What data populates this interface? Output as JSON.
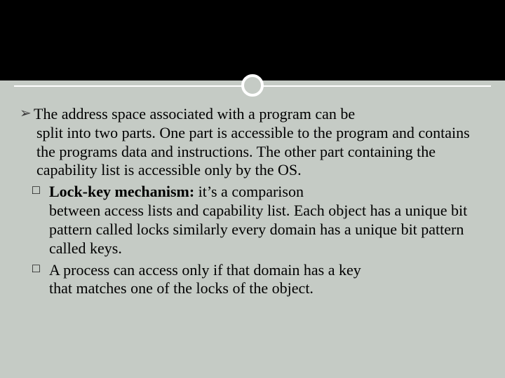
{
  "bullets": {
    "b1": {
      "marker": "➢",
      "first": "The address space associated with a program can be",
      "rest": "split into two parts. One part is accessible to the program and contains the programs data and instructions. The other part containing the capability list is accessible only by the  OS."
    },
    "b2": {
      "marker": "□",
      "bold": "Lock-key mechanism:",
      "first": " it’s a comparison",
      "rest": "between access lists and capability list. Each object has a unique bit pattern called locks similarly every domain has  a unique bit pattern called keys."
    },
    "b3": {
      "marker": "□",
      "first": "A process can access only if that  domain has a key",
      "rest": "that matches one of the locks of the object."
    }
  }
}
